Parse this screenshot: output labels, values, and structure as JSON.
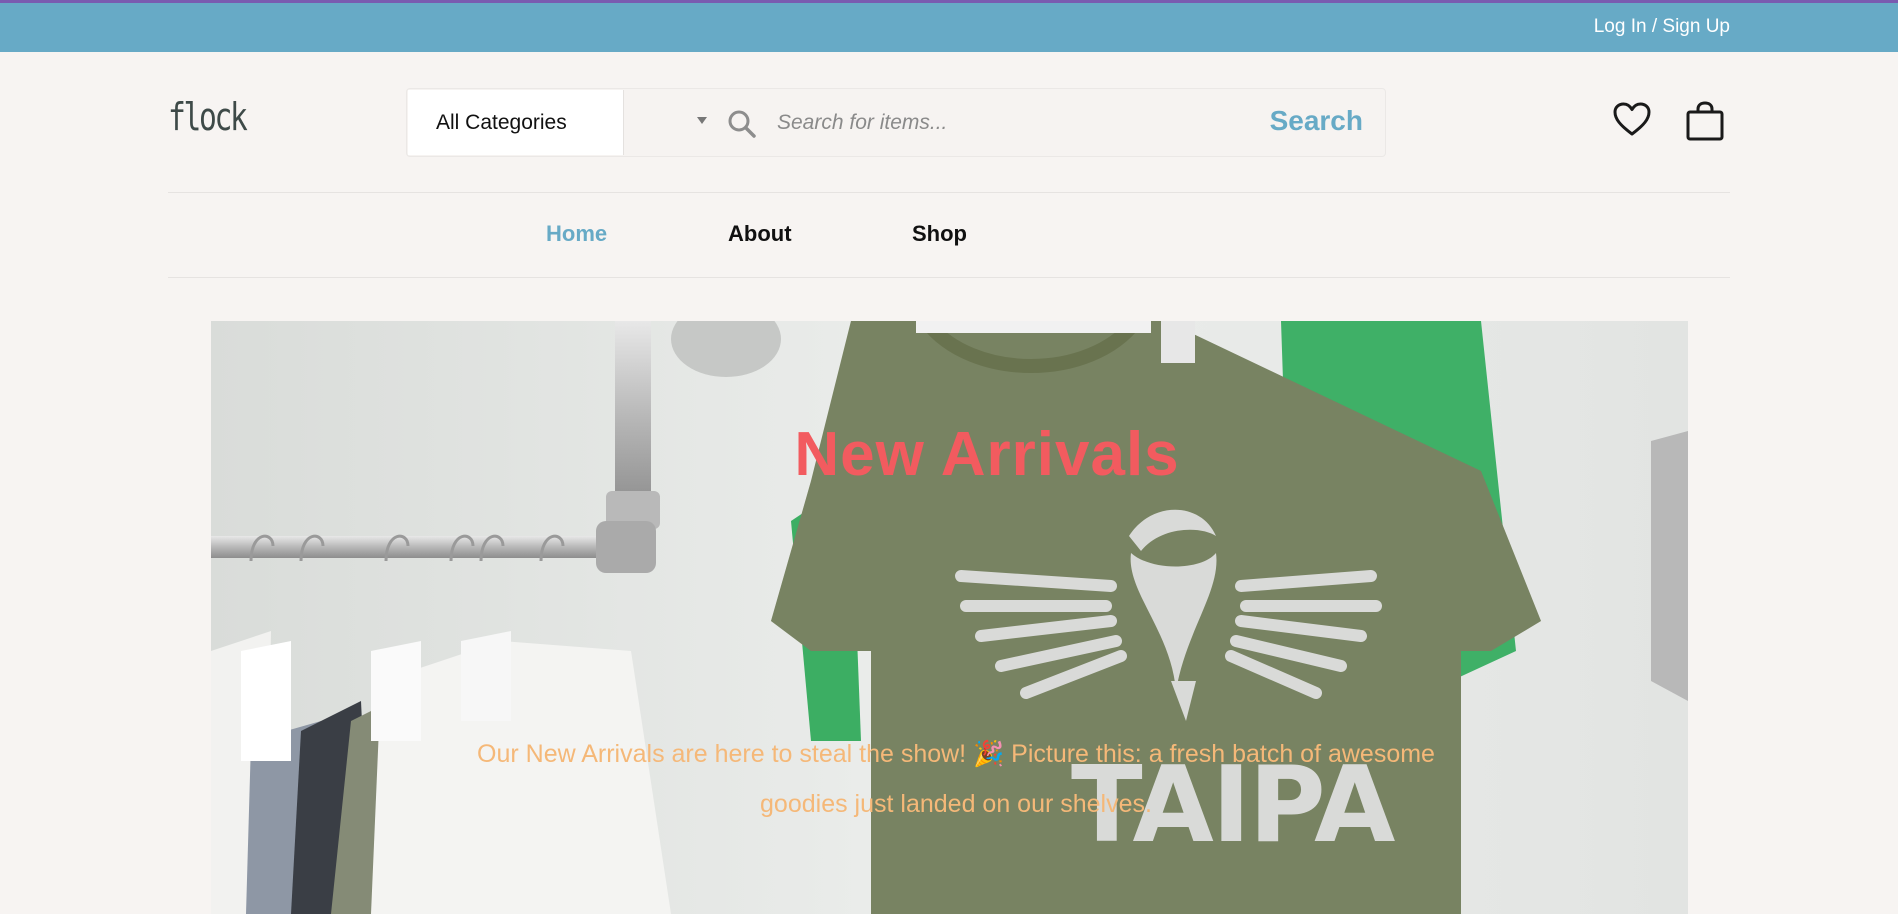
{
  "topbar": {
    "login_label": "Log In / Sign Up"
  },
  "header": {
    "logo": "flock",
    "category_select": "All Categories",
    "search_placeholder": "Search for items...",
    "search_button": "Search"
  },
  "nav": {
    "items": [
      {
        "label": "Home",
        "active": true
      },
      {
        "label": "About",
        "active": false
      },
      {
        "label": "Shop",
        "active": false
      }
    ]
  },
  "hero": {
    "title": "New Arrivals",
    "text": "Our New Arrivals are here to steal the show! 🎉 Picture this: a fresh batch of awesome goodies just landed on our shelves.",
    "shirt_print": "TAIPA"
  },
  "colors": {
    "accent": "#67aac6",
    "topbar_border": "#7a5bb0",
    "hero_title": "#f25b5f",
    "hero_text": "#f5b878",
    "background": "#f7f4f2"
  },
  "icons": [
    "search-icon",
    "heart-icon",
    "shopping-bag-icon",
    "chevron-down-icon"
  ]
}
